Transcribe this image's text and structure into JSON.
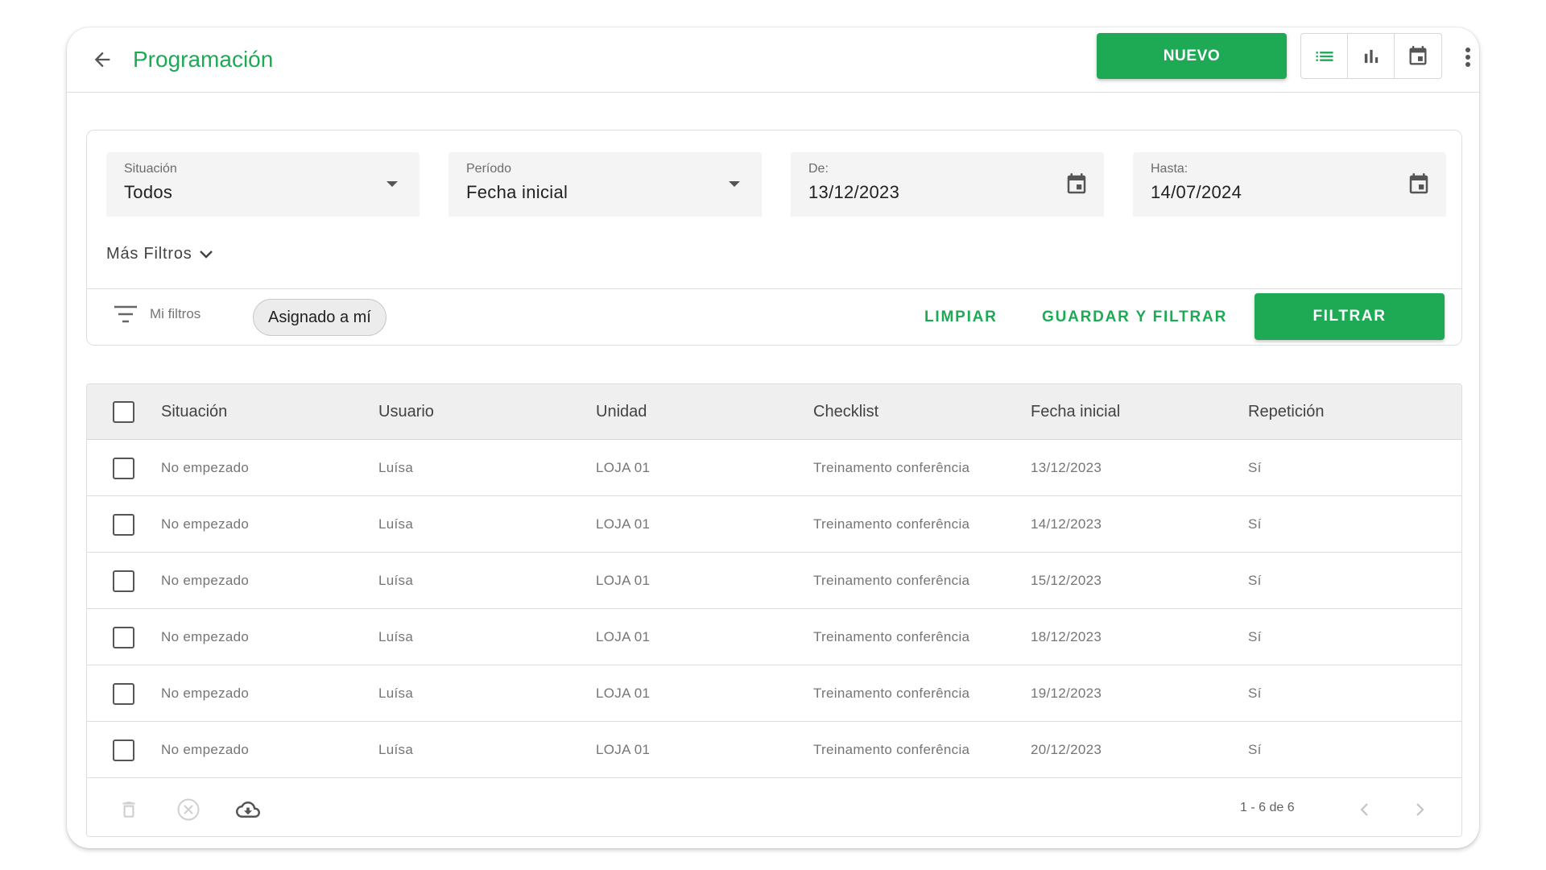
{
  "header": {
    "title": "Programación",
    "new_label": "NUEVO",
    "views": [
      "list-view",
      "chart-view",
      "calendar-view"
    ]
  },
  "filters": {
    "situacion": {
      "label": "Situación",
      "value": "Todos"
    },
    "periodo": {
      "label": "Período",
      "value": "Fecha inicial"
    },
    "desde": {
      "label": "De:",
      "value": "13/12/2023"
    },
    "hasta": {
      "label": "Hasta:",
      "value": "14/07/2024"
    },
    "more_filters": "Más Filtros",
    "my_filters": "Mi filtros",
    "chip": "Asignado a mí",
    "clear": "LIMPIAR",
    "save_filter": "GUARDAR Y FILTRAR",
    "filter": "FILTRAR"
  },
  "table": {
    "columns": [
      "Situación",
      "Usuario",
      "Unidad",
      "Checklist",
      "Fecha inicial",
      "Repetición"
    ],
    "rows": [
      [
        "No empezado",
        "Luísa",
        "LOJA 01",
        "Treinamento conferência",
        "13/12/2023",
        "Sí"
      ],
      [
        "No empezado",
        "Luísa",
        "LOJA 01",
        "Treinamento conferência",
        "14/12/2023",
        "Sí"
      ],
      [
        "No empezado",
        "Luísa",
        "LOJA 01",
        "Treinamento conferência",
        "15/12/2023",
        "Sí"
      ],
      [
        "No empezado",
        "Luísa",
        "LOJA 01",
        "Treinamento conferência",
        "18/12/2023",
        "Sí"
      ],
      [
        "No empezado",
        "Luísa",
        "LOJA 01",
        "Treinamento conferência",
        "19/12/2023",
        "Sí"
      ],
      [
        "No empezado",
        "Luísa",
        "LOJA 01",
        "Treinamento conferência",
        "20/12/2023",
        "Sí"
      ]
    ],
    "pagination": "1 - 6 de 6"
  },
  "colors": {
    "accent": "#1eaa55",
    "header_bg": "#efefef",
    "field_bg": "#f4f4f4"
  }
}
